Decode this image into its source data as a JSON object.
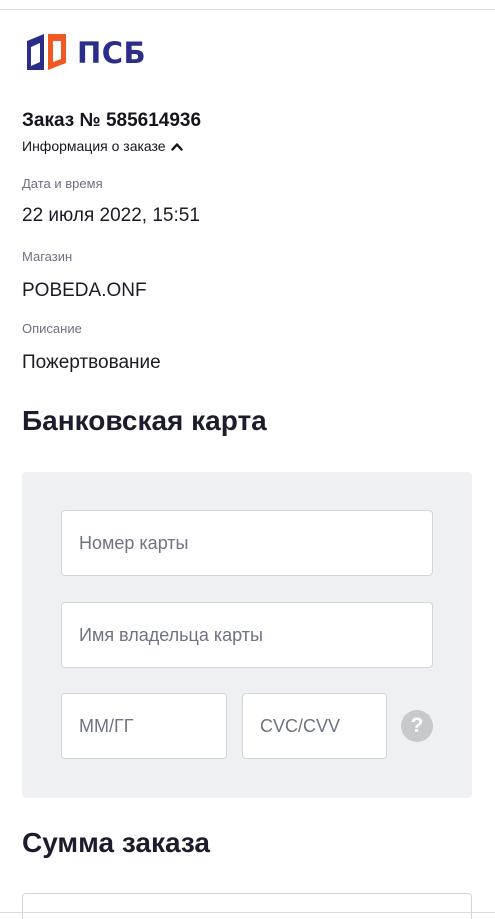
{
  "header": {
    "logo_text": "ПСБ",
    "brand_colors": {
      "blue": "#2b2d8a",
      "orange": "#f05a22"
    }
  },
  "order": {
    "title": "Заказ № 585614936",
    "info_toggle_label": "Информация о заказе",
    "toggle_icon": "chevron-up-icon",
    "fields": {
      "datetime_label": "Дата и время",
      "datetime_value": "22 июля 2022, 15:51",
      "store_label": "Магазин",
      "store_value": "POBEDA.ONF",
      "description_label": "Описание",
      "description_value": "Пожертвование"
    }
  },
  "bank_card": {
    "section_title": "Банковская карта",
    "card_number_placeholder": "Номер карты",
    "holder_name_placeholder": "Имя владельца карты",
    "expiry_placeholder": "ММ/ГГ",
    "cvc_placeholder": "CVC/CVV",
    "help_icon": "question-circle-icon",
    "help_glyph": "?"
  },
  "order_total": {
    "section_title": "Сумма заказа"
  }
}
